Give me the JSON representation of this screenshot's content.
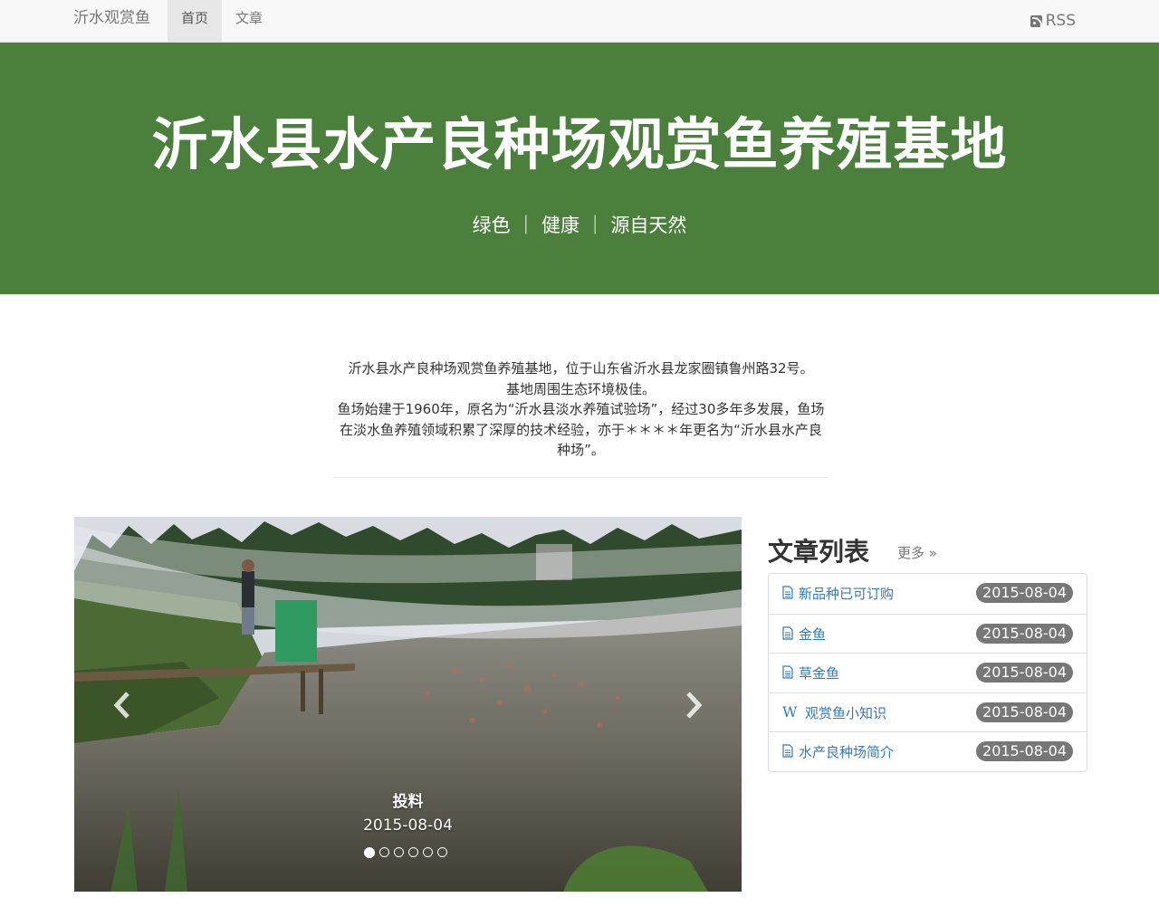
{
  "navbar": {
    "brand": "沂水观赏鱼",
    "items": [
      {
        "label": "首页",
        "active": true
      },
      {
        "label": "文章",
        "active": false
      }
    ],
    "rss_label": "RSS"
  },
  "hero": {
    "title": "沂水县水产良种场观赏鱼养殖基地",
    "subtitle": "绿色 ｜ 健康 ｜ 源自天然",
    "background_color": "#4a7f3c"
  },
  "intro": {
    "lines": [
      "沂水县水产良种场观赏鱼养殖基地，位于山东省沂水县龙家圈镇鲁州路32号。",
      "基地周围生态环境极佳。",
      "鱼场始建于1960年，原名为“沂水县淡水养殖试验场”，经过30多年多发展，鱼场在淡水鱼养殖领域积累了深厚的技术经验，亦于＊＊＊＊年更名为“沂水县水产良种场”。"
    ]
  },
  "carousel": {
    "caption_title": "投料",
    "caption_date": "2015-08-04",
    "slide_count": 6,
    "active_index": 0
  },
  "articles": {
    "heading": "文章列表",
    "more_label": "更多 »",
    "items": [
      {
        "icon": "document-icon",
        "title": "新品种已可订购",
        "date": "2015-08-04"
      },
      {
        "icon": "document-icon",
        "title": "金鱼",
        "date": "2015-08-04"
      },
      {
        "icon": "document-icon",
        "title": "草金鱼",
        "date": "2015-08-04"
      },
      {
        "icon": "wiki-icon",
        "title": "观赏鱼小知识",
        "date": "2015-08-04"
      },
      {
        "icon": "document-icon",
        "title": "水产良种场简介",
        "date": "2015-08-04"
      }
    ]
  }
}
